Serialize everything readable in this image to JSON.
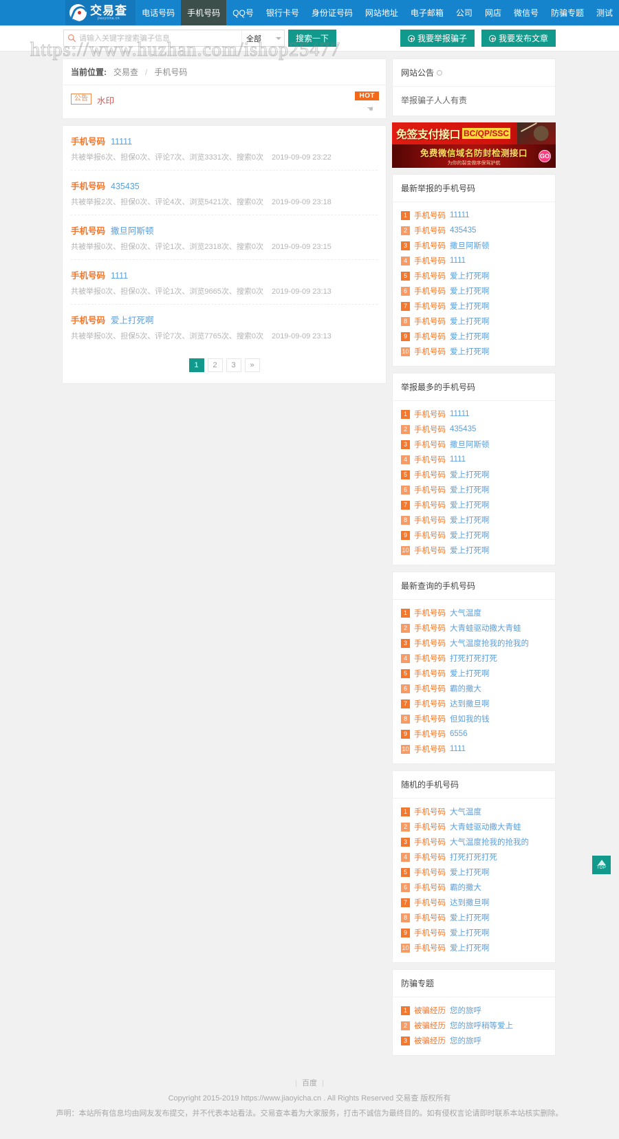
{
  "site": {
    "logo_cn": "交易查",
    "logo_en": "jiaoyicha.cn",
    "watermark": "https://www.huzhan.com/ishop25477"
  },
  "nav": {
    "items": [
      {
        "label": "电话号码",
        "active": false
      },
      {
        "label": "手机号码",
        "active": true
      },
      {
        "label": "QQ号",
        "active": false
      },
      {
        "label": "银行卡号",
        "active": false
      },
      {
        "label": "身份证号码",
        "active": false
      },
      {
        "label": "网站地址",
        "active": false
      },
      {
        "label": "电子邮箱",
        "active": false
      },
      {
        "label": "公司",
        "active": false
      },
      {
        "label": "网店",
        "active": false
      },
      {
        "label": "微信号",
        "active": false
      },
      {
        "label": "防骗专题",
        "active": false
      },
      {
        "label": "测试",
        "active": false
      }
    ]
  },
  "search": {
    "placeholder": "请输入关键字搜索骗子信息",
    "value": "",
    "scope": "全部",
    "button": "搜索一下"
  },
  "header_actions": {
    "report": "我要举报骗子",
    "publish": "我要发布文章"
  },
  "breadcrumb": {
    "label": "当前位置:",
    "home": "交易查",
    "sep": "/",
    "current": "手机号码"
  },
  "notice": {
    "tag": "公告",
    "title": "水印",
    "badge": "HOT",
    "hand": "☚"
  },
  "list": [
    {
      "category": "手机号码",
      "name": "11111",
      "meta": "共被举报6次、担保0次、评论7次、浏览3331次、搜索0次",
      "date": "2019-09-09 23:22"
    },
    {
      "category": "手机号码",
      "name": "435435",
      "meta": "共被举报2次、担保0次、评论4次、浏览5421次、搜索0次",
      "date": "2019-09-09 23:18"
    },
    {
      "category": "手机号码",
      "name": "撒旦阿斯顿",
      "meta": "共被举报0次、担保0次、评论1次、浏览2318次、搜索0次",
      "date": "2019-09-09 23:15"
    },
    {
      "category": "手机号码",
      "name": "1111",
      "meta": "共被举报0次、担保0次、评论1次、浏览9665次、搜索0次",
      "date": "2019-09-09 23:13"
    },
    {
      "category": "手机号码",
      "name": "爱上打死啊",
      "meta": "共被举报0次、担保5次、评论7次、浏览7765次、搜索0次",
      "date": "2019-09-09 23:13"
    }
  ],
  "pagination": {
    "pages": [
      "1",
      "2",
      "3",
      "»"
    ],
    "current": "1"
  },
  "sidebar": {
    "announcement": {
      "title": "网站公告",
      "icon": "rss-icon",
      "text": "举报骗子人人有责"
    },
    "banners": [
      {
        "main": "免签支付接口",
        "badge": "BC/QP/SSC"
      },
      {
        "main": "免费微信域名防封检测接口",
        "sub": "为你的裂变做序保驾护航",
        "go": "GO"
      }
    ],
    "sections": [
      {
        "title": "最新举报的手机号码",
        "rows": [
          {
            "num": "1",
            "cat": "手机号码",
            "name": "11111"
          },
          {
            "num": "2",
            "cat": "手机号码",
            "name": "435435"
          },
          {
            "num": "3",
            "cat": "手机号码",
            "name": "撒旦阿斯顿"
          },
          {
            "num": "4",
            "cat": "手机号码",
            "name": "1111"
          },
          {
            "num": "5",
            "cat": "手机号码",
            "name": "爱上打死啊"
          },
          {
            "num": "6",
            "cat": "手机号码",
            "name": "爱上打死啊"
          },
          {
            "num": "7",
            "cat": "手机号码",
            "name": "爱上打死啊"
          },
          {
            "num": "8",
            "cat": "手机号码",
            "name": "爱上打死啊"
          },
          {
            "num": "9",
            "cat": "手机号码",
            "name": "爱上打死啊"
          },
          {
            "num": "10",
            "cat": "手机号码",
            "name": "爱上打死啊"
          }
        ]
      },
      {
        "title": "举报最多的手机号码",
        "rows": [
          {
            "num": "1",
            "cat": "手机号码",
            "name": "11111"
          },
          {
            "num": "2",
            "cat": "手机号码",
            "name": "435435"
          },
          {
            "num": "3",
            "cat": "手机号码",
            "name": "撒旦阿斯顿"
          },
          {
            "num": "4",
            "cat": "手机号码",
            "name": "1111"
          },
          {
            "num": "5",
            "cat": "手机号码",
            "name": "爱上打死啊"
          },
          {
            "num": "6",
            "cat": "手机号码",
            "name": "爱上打死啊"
          },
          {
            "num": "7",
            "cat": "手机号码",
            "name": "爱上打死啊"
          },
          {
            "num": "8",
            "cat": "手机号码",
            "name": "爱上打死啊"
          },
          {
            "num": "9",
            "cat": "手机号码",
            "name": "爱上打死啊"
          },
          {
            "num": "10",
            "cat": "手机号码",
            "name": "爱上打死啊"
          }
        ]
      },
      {
        "title": "最新查询的手机号码",
        "rows": [
          {
            "num": "1",
            "cat": "手机号码",
            "name": "大气温度"
          },
          {
            "num": "2",
            "cat": "手机号码",
            "name": "大青蛙驱动撒大青蛙"
          },
          {
            "num": "3",
            "cat": "手机号码",
            "name": "大气温度抢我的抢我的"
          },
          {
            "num": "4",
            "cat": "手机号码",
            "name": "打死打死打死"
          },
          {
            "num": "5",
            "cat": "手机号码",
            "name": "爱上打死啊"
          },
          {
            "num": "6",
            "cat": "手机号码",
            "name": "霸的撒大"
          },
          {
            "num": "7",
            "cat": "手机号码",
            "name": "达到撒旦啊"
          },
          {
            "num": "8",
            "cat": "手机号码",
            "name": "但如我的钱"
          },
          {
            "num": "9",
            "cat": "手机号码",
            "name": "6556"
          },
          {
            "num": "10",
            "cat": "手机号码",
            "name": "1111"
          }
        ]
      },
      {
        "title": "随机的手机号码",
        "rows": [
          {
            "num": "1",
            "cat": "手机号码",
            "name": "大气温度"
          },
          {
            "num": "2",
            "cat": "手机号码",
            "name": "大青蛙驱动撒大青蛙"
          },
          {
            "num": "3",
            "cat": "手机号码",
            "name": "大气温度抢我的抢我的"
          },
          {
            "num": "4",
            "cat": "手机号码",
            "name": "打死打死打死"
          },
          {
            "num": "5",
            "cat": "手机号码",
            "name": "爱上打死啊"
          },
          {
            "num": "6",
            "cat": "手机号码",
            "name": "霸的撒大"
          },
          {
            "num": "7",
            "cat": "手机号码",
            "name": "达到撒旦啊"
          },
          {
            "num": "8",
            "cat": "手机号码",
            "name": "爱上打死啊"
          },
          {
            "num": "9",
            "cat": "手机号码",
            "name": "爱上打死啊"
          },
          {
            "num": "10",
            "cat": "手机号码",
            "name": "爱上打死啊"
          }
        ]
      },
      {
        "title": "防骗专题",
        "rows": [
          {
            "num": "1",
            "cat": "被骗经历",
            "name": "您的旅呼"
          },
          {
            "num": "2",
            "cat": "被骗经历",
            "name": "您的旅呼稍等爱上"
          },
          {
            "num": "3",
            "cat": "被骗经历",
            "name": "您的旅呼"
          }
        ]
      }
    ]
  },
  "footer": {
    "link": "百度",
    "copyright": "Copyright 2015-2019 https://www.jiaoyicha.cn . All Rights Reserved 交易查 版权所有",
    "disclaimer": "声明：本站所有信息均由网友发布提交，并不代表本站看法。交易查本着为大家服务，打击不诚信为最终目的。如有侵权言论请即时联系本站核实删除。"
  },
  "totop": {
    "label": "TOP"
  }
}
